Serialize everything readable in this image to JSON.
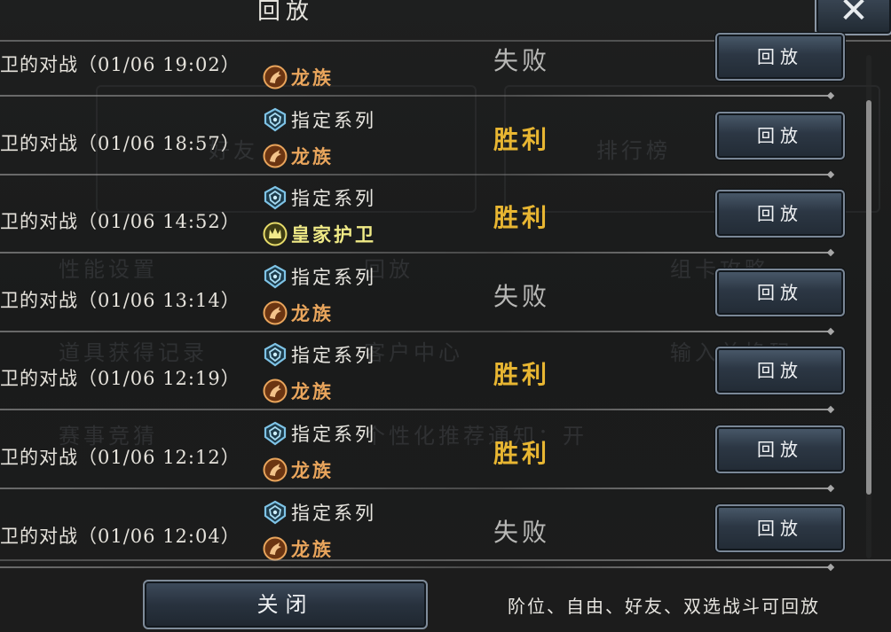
{
  "dialog": {
    "title": "回放",
    "close_icon": "✕",
    "close_button_label": "关闭",
    "hint": "阶位、自由、好友、双选战斗可回放"
  },
  "background_ui": {
    "items": [
      "好友",
      "排行榜",
      "性能设置",
      "回放",
      "组卡攻略",
      "道具获得记录",
      "客户中心",
      "输入兑换码",
      "赛事竞猜",
      "个性化推荐通知：开"
    ]
  },
  "records": [
    {
      "match": "卫的对战（01/06 19:02）",
      "series": "",
      "faction": "龙族",
      "faction_icon": "dragon-icon",
      "result": "失败",
      "outcome": "lose",
      "button": "回放"
    },
    {
      "match": "卫的对战（01/06 18:57）",
      "series": "指定系列",
      "faction": "龙族",
      "faction_icon": "dragon-icon",
      "result": "胜利",
      "outcome": "win",
      "button": "回放"
    },
    {
      "match": "卫的对战（01/06 14:52）",
      "series": "指定系列",
      "faction": "皇家护卫",
      "faction_icon": "crown-icon",
      "result": "胜利",
      "outcome": "win",
      "button": "回放"
    },
    {
      "match": "卫的对战（01/06 13:14）",
      "series": "指定系列",
      "faction": "龙族",
      "faction_icon": "dragon-icon",
      "result": "失败",
      "outcome": "lose",
      "button": "回放"
    },
    {
      "match": "卫的对战（01/06 12:19）",
      "series": "指定系列",
      "faction": "龙族",
      "faction_icon": "dragon-icon",
      "result": "胜利",
      "outcome": "win",
      "button": "回放"
    },
    {
      "match": "卫的对战（01/06 12:12）",
      "series": "指定系列",
      "faction": "龙族",
      "faction_icon": "dragon-icon",
      "result": "胜利",
      "outcome": "win",
      "button": "回放"
    },
    {
      "match": "卫的对战（01/06 12:04）",
      "series": "指定系列",
      "faction": "龙族",
      "faction_icon": "dragon-icon",
      "result": "失败",
      "outcome": "lose",
      "button": "回放"
    }
  ],
  "colors": {
    "win": "#e8b632",
    "lose": "#b8b8b6",
    "dragon_faction": "#e9a55c",
    "royal_guard_faction": "#f0ea86",
    "series_icon": "#7ec3e6"
  }
}
